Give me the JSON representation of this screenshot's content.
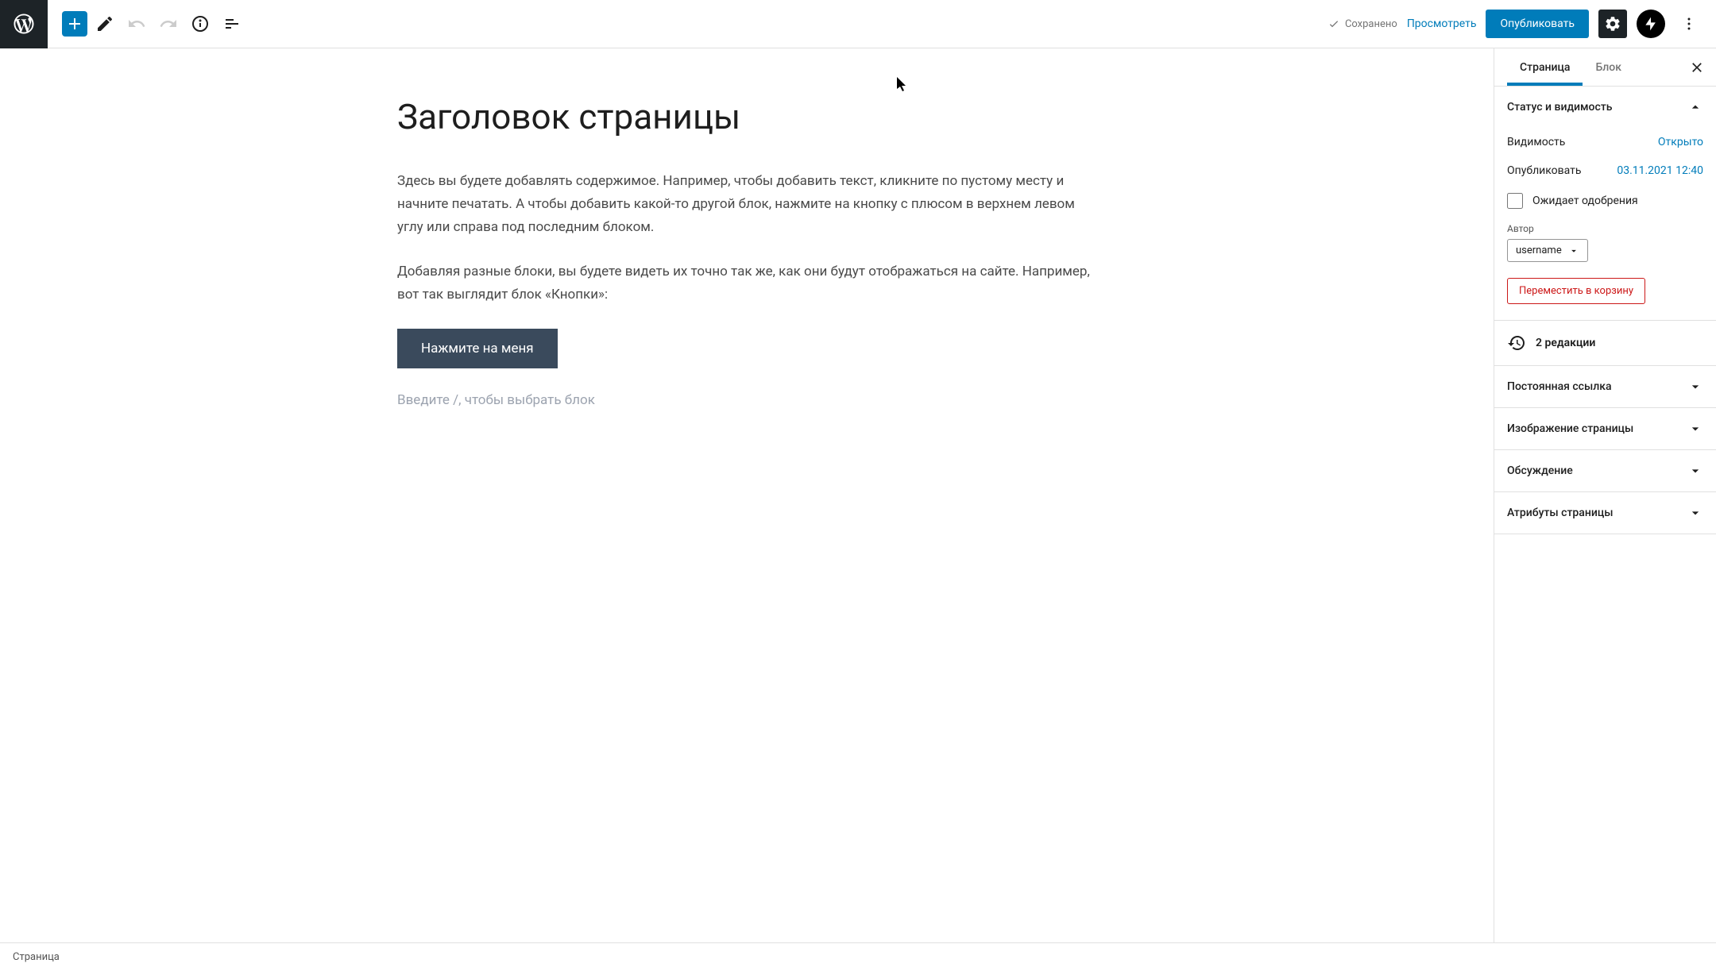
{
  "toolbar": {
    "saved_label": "Сохранено",
    "preview_label": "Просмотреть",
    "publish_label": "Опубликовать"
  },
  "editor": {
    "title": "Заголовок страницы",
    "para1": "Здесь вы будете добавлять содержимое. Например, чтобы добавить текст, кликните по пустому месту и начните печатать. А чтобы добавить какой-то другой блок, нажмите на кнопку с плюсом в верхнем левом углу или справа под последним блоком.",
    "para2": "Добавляя разные блоки, вы будете видеть их точно так же, как они будут отображаться на сайте. Например, вот так выглядит блок «Кнопки»:",
    "button_label": "Нажмите на меня",
    "placeholder": "Введите /, чтобы выбрать блок"
  },
  "sidebar": {
    "tabs": {
      "page": "Страница",
      "block": "Блок"
    },
    "status_panel": {
      "title": "Статус и видимость",
      "visibility_label": "Видимость",
      "visibility_value": "Открыто",
      "publish_label": "Опубликовать",
      "publish_value": "03.11.2021 12:40",
      "pending_label": "Ожидает одобрения",
      "author_label": "Автор",
      "author_value": "username",
      "trash_label": "Переместить в корзину"
    },
    "revisions_label": "2 редакции",
    "permalink_label": "Постоянная ссылка",
    "featured_image_label": "Изображение страницы",
    "discussion_label": "Обсуждение",
    "page_attributes_label": "Атрибуты страницы"
  },
  "footer": {
    "breadcrumb": "Страница"
  }
}
